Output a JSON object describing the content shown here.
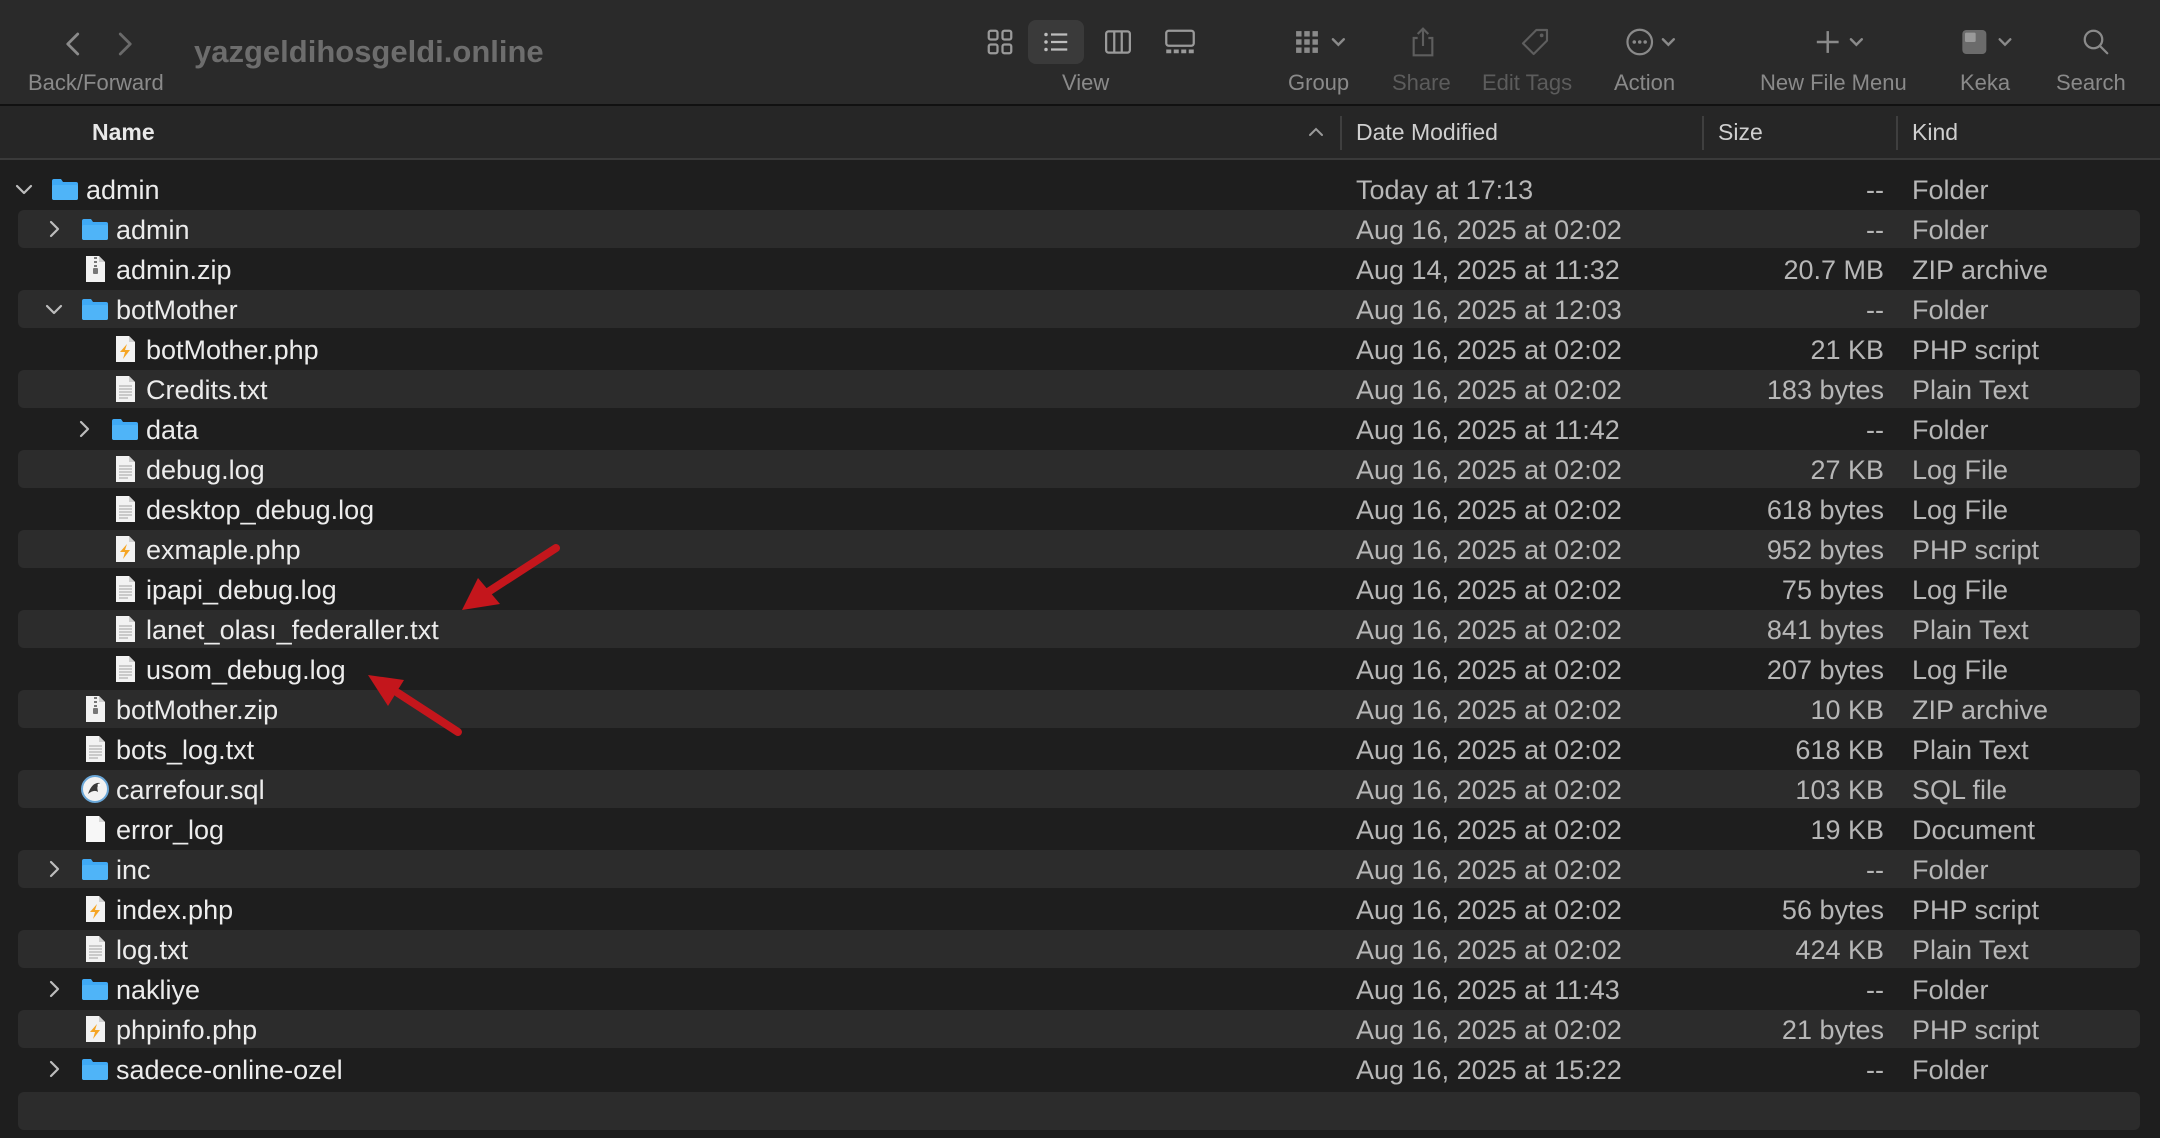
{
  "window": {
    "title": "yazgeldihosgeldi.online"
  },
  "toolbar": {
    "back_forward_label": "Back/Forward",
    "view_label": "View",
    "group_label": "Group",
    "share_label": "Share",
    "edit_tags_label": "Edit Tags",
    "action_label": "Action",
    "new_file_menu_label": "New File Menu",
    "keka_label": "Keka",
    "search_label": "Search",
    "active_view": "list"
  },
  "columns": {
    "name": "Name",
    "date_modified": "Date Modified",
    "size": "Size",
    "kind": "Kind",
    "sorted_by": "Name",
    "sort_direction": "ascending"
  },
  "colors": {
    "folder": "#3fa9f5",
    "php_badge": "#f5a524",
    "annotation_arrow": "#c4161c",
    "row_alt": "#2c2c2c"
  },
  "rows": [
    {
      "name": "admin",
      "date": "Today at 17:13",
      "size": "--",
      "kind": "Folder",
      "icon": "folder-icon",
      "depth": 0,
      "disclosure": "expanded"
    },
    {
      "name": "admin",
      "date": "Aug 16, 2025 at 02:02",
      "size": "--",
      "kind": "Folder",
      "icon": "folder-icon",
      "depth": 1,
      "disclosure": "collapsed"
    },
    {
      "name": "admin.zip",
      "date": "Aug 14, 2025 at 11:32",
      "size": "20.7 MB",
      "kind": "ZIP archive",
      "icon": "zip-file-icon",
      "depth": 1,
      "disclosure": "none"
    },
    {
      "name": "botMother",
      "date": "Aug 16, 2025 at 12:03",
      "size": "--",
      "kind": "Folder",
      "icon": "folder-icon",
      "depth": 1,
      "disclosure": "expanded"
    },
    {
      "name": "botMother.php",
      "date": "Aug 16, 2025 at 02:02",
      "size": "21 KB",
      "kind": "PHP script",
      "icon": "php-file-icon",
      "depth": 2,
      "disclosure": "none"
    },
    {
      "name": "Credits.txt",
      "date": "Aug 16, 2025 at 02:02",
      "size": "183 bytes",
      "kind": "Plain Text",
      "icon": "text-file-icon",
      "depth": 2,
      "disclosure": "none"
    },
    {
      "name": "data",
      "date": "Aug 16, 2025 at 11:42",
      "size": "--",
      "kind": "Folder",
      "icon": "folder-icon",
      "depth": 2,
      "disclosure": "collapsed"
    },
    {
      "name": "debug.log",
      "date": "Aug 16, 2025 at 02:02",
      "size": "27 KB",
      "kind": "Log File",
      "icon": "text-file-icon",
      "depth": 2,
      "disclosure": "none"
    },
    {
      "name": "desktop_debug.log",
      "date": "Aug 16, 2025 at 02:02",
      "size": "618 bytes",
      "kind": "Log File",
      "icon": "text-file-icon",
      "depth": 2,
      "disclosure": "none"
    },
    {
      "name": "exmaple.php",
      "date": "Aug 16, 2025 at 02:02",
      "size": "952 bytes",
      "kind": "PHP script",
      "icon": "php-file-icon",
      "depth": 2,
      "disclosure": "none"
    },
    {
      "name": "ipapi_debug.log",
      "date": "Aug 16, 2025 at 02:02",
      "size": "75 bytes",
      "kind": "Log File",
      "icon": "text-file-icon",
      "depth": 2,
      "disclosure": "none"
    },
    {
      "name": "lanet_olası_federaller.txt",
      "date": "Aug 16, 2025 at 02:02",
      "size": "841 bytes",
      "kind": "Plain Text",
      "icon": "text-file-icon",
      "depth": 2,
      "disclosure": "none"
    },
    {
      "name": "usom_debug.log",
      "date": "Aug 16, 2025 at 02:02",
      "size": "207 bytes",
      "kind": "Log File",
      "icon": "text-file-icon",
      "depth": 2,
      "disclosure": "none"
    },
    {
      "name": "botMother.zip",
      "date": "Aug 16, 2025 at 02:02",
      "size": "10 KB",
      "kind": "ZIP archive",
      "icon": "zip-file-icon",
      "depth": 1,
      "disclosure": "none"
    },
    {
      "name": "bots_log.txt",
      "date": "Aug 16, 2025 at 02:02",
      "size": "618 KB",
      "kind": "Plain Text",
      "icon": "text-file-icon",
      "depth": 1,
      "disclosure": "none"
    },
    {
      "name": "carrefour.sql",
      "date": "Aug 16, 2025 at 02:02",
      "size": "103 KB",
      "kind": "SQL file",
      "icon": "sql-file-icon",
      "depth": 1,
      "disclosure": "none"
    },
    {
      "name": "error_log",
      "date": "Aug 16, 2025 at 02:02",
      "size": "19 KB",
      "kind": "Document",
      "icon": "blank-document-icon",
      "depth": 1,
      "disclosure": "none"
    },
    {
      "name": "inc",
      "date": "Aug 16, 2025 at 02:02",
      "size": "--",
      "kind": "Folder",
      "icon": "folder-icon",
      "depth": 1,
      "disclosure": "collapsed"
    },
    {
      "name": "index.php",
      "date": "Aug 16, 2025 at 02:02",
      "size": "56 bytes",
      "kind": "PHP script",
      "icon": "php-file-icon",
      "depth": 1,
      "disclosure": "none"
    },
    {
      "name": "log.txt",
      "date": "Aug 16, 2025 at 02:02",
      "size": "424 KB",
      "kind": "Plain Text",
      "icon": "text-file-icon",
      "depth": 1,
      "disclosure": "none"
    },
    {
      "name": "nakliye",
      "date": "Aug 16, 2025 at 11:43",
      "size": "--",
      "kind": "Folder",
      "icon": "folder-icon",
      "depth": 1,
      "disclosure": "collapsed"
    },
    {
      "name": "phpinfo.php",
      "date": "Aug 16, 2025 at 02:02",
      "size": "21 bytes",
      "kind": "PHP script",
      "icon": "php-file-icon",
      "depth": 1,
      "disclosure": "none"
    },
    {
      "name": "sadece-online-ozel",
      "date": "Aug 16, 2025 at 15:22",
      "size": "--",
      "kind": "Folder",
      "icon": "folder-icon",
      "depth": 1,
      "disclosure": "collapsed"
    }
  ],
  "annotations": [
    {
      "type": "arrow",
      "color": "#c4161c",
      "points_to": "lanet_olası_federaller.txt"
    },
    {
      "type": "arrow",
      "color": "#c4161c",
      "points_to": "usom_debug.log"
    }
  ]
}
